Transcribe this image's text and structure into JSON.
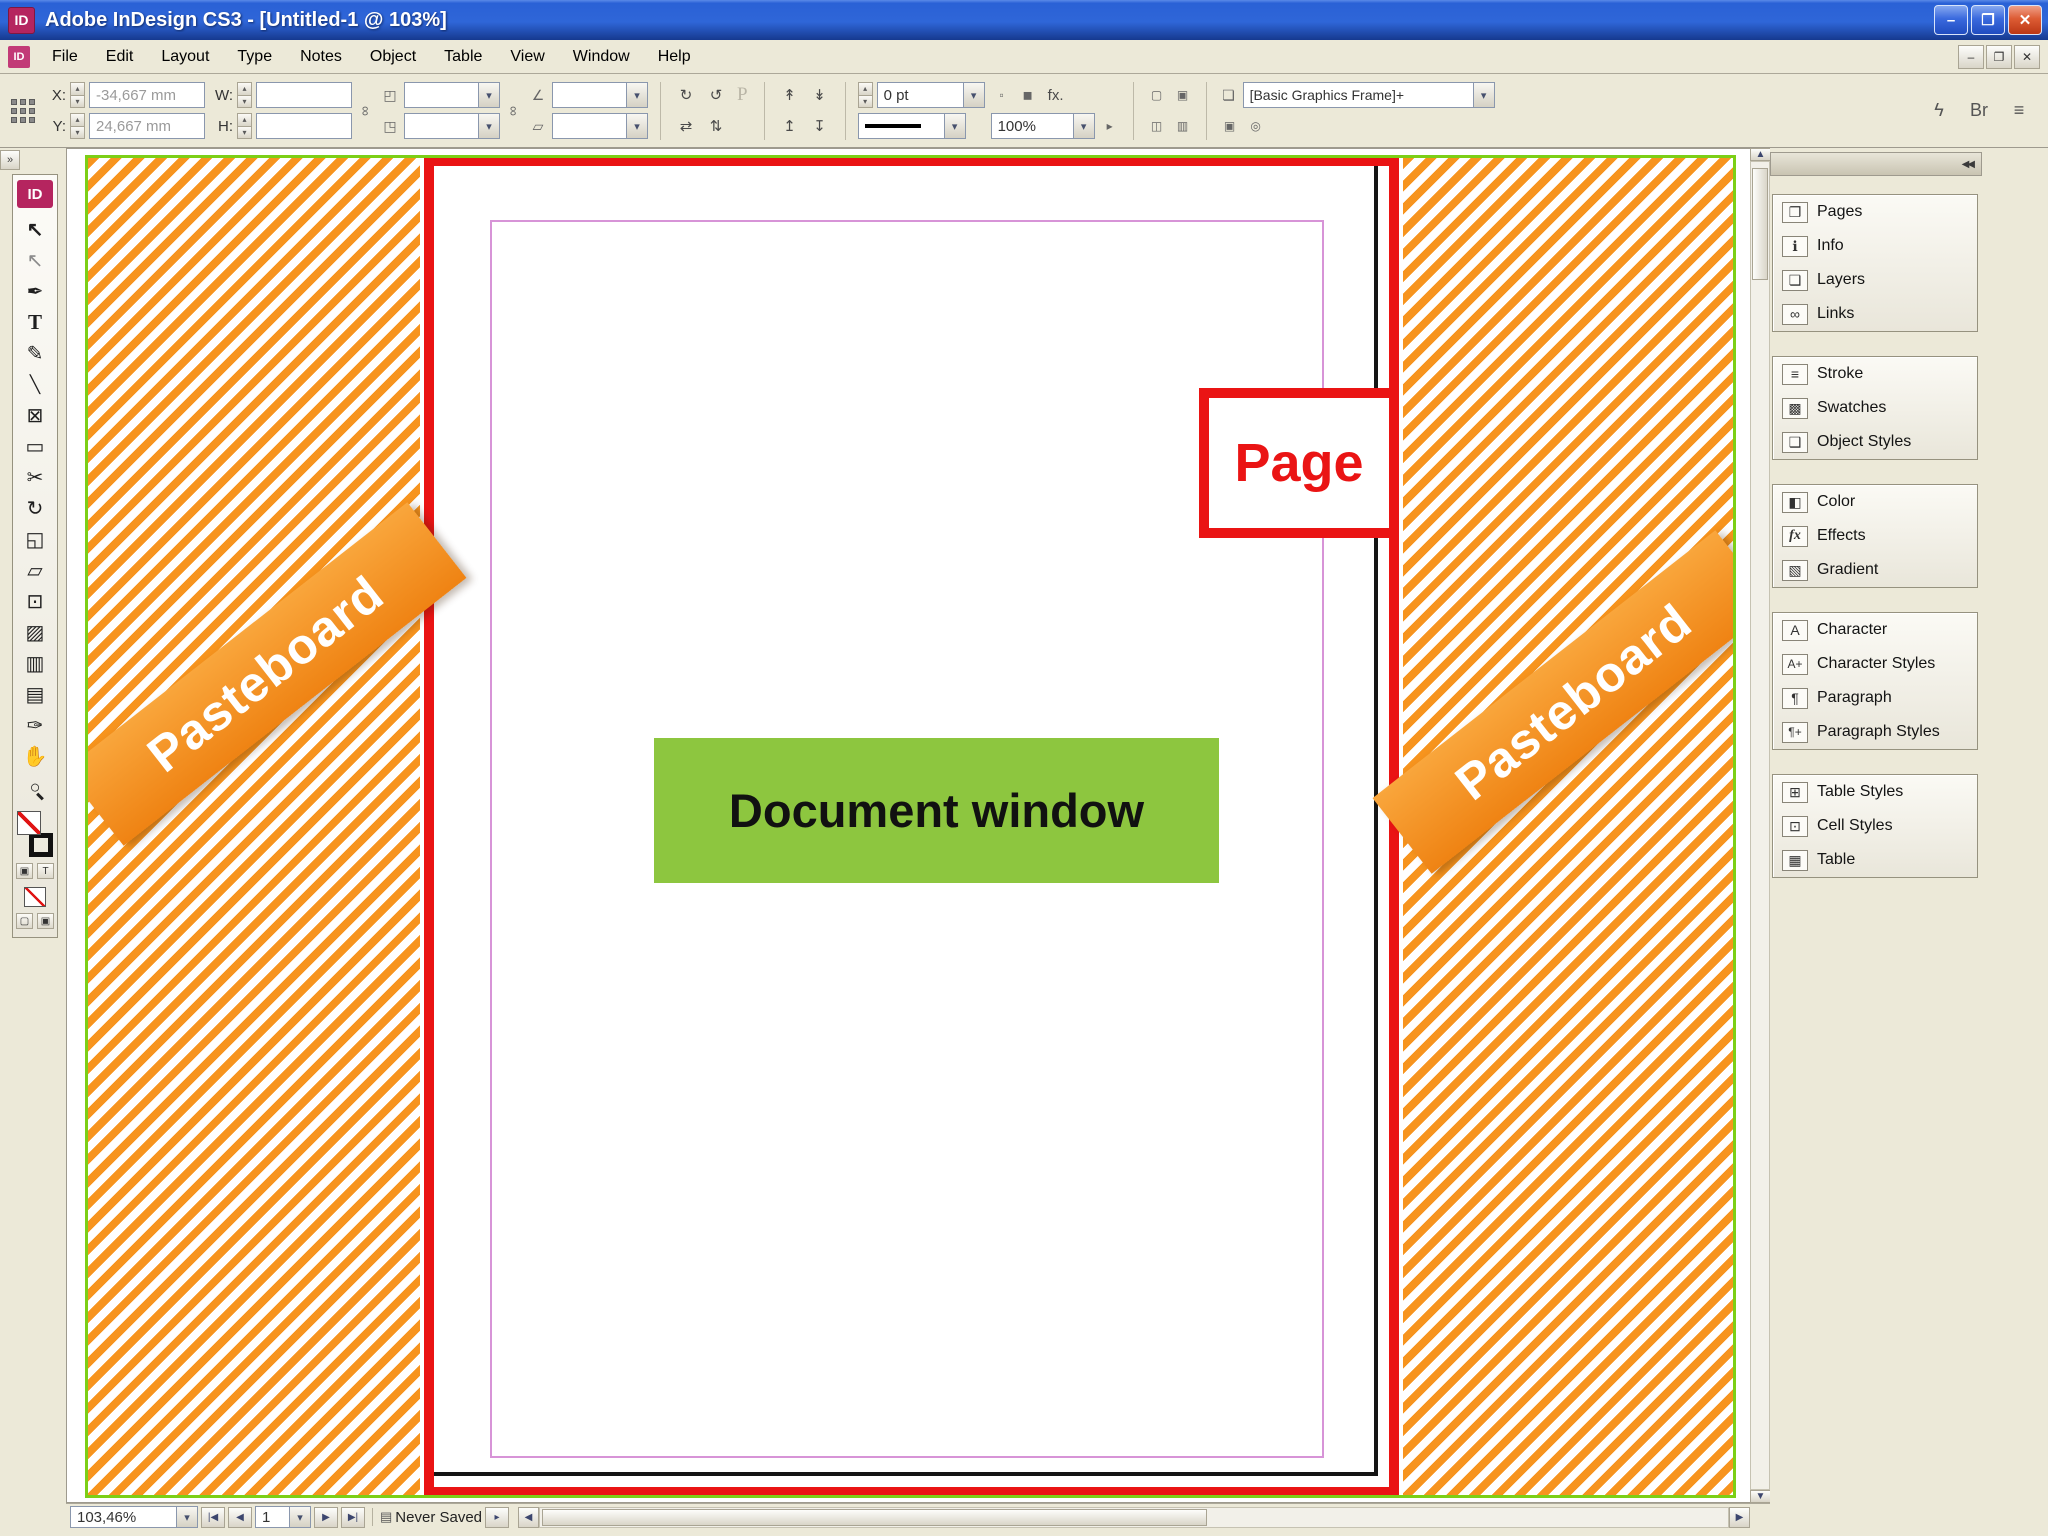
{
  "window": {
    "title": "Adobe InDesign CS3 - [Untitled-1 @ 103%]",
    "app_icon": "ID",
    "controls": {
      "minimize": "–",
      "restore": "❐",
      "close": "✕"
    }
  },
  "menubar": {
    "doc_icon": "ID",
    "items": [
      {
        "name": "menu-file",
        "label": "File"
      },
      {
        "name": "menu-edit",
        "label": "Edit"
      },
      {
        "name": "menu-layout",
        "label": "Layout"
      },
      {
        "name": "menu-type",
        "label": "Type"
      },
      {
        "name": "menu-notes",
        "label": "Notes"
      },
      {
        "name": "menu-object",
        "label": "Object"
      },
      {
        "name": "menu-table",
        "label": "Table"
      },
      {
        "name": "menu-view",
        "label": "View"
      },
      {
        "name": "menu-window",
        "label": "Window"
      },
      {
        "name": "menu-help",
        "label": "Help"
      }
    ],
    "doc_controls": {
      "minimize": "–",
      "restore": "❐",
      "close": "✕"
    }
  },
  "control_panel": {
    "x_label": "X:",
    "x_value": "-34,667 mm",
    "y_label": "Y:",
    "y_value": "24,667 mm",
    "w_label": "W:",
    "w_value": "",
    "h_label": "H:",
    "h_value": "",
    "scale_x_value": "",
    "scale_y_value": "",
    "rotation_value": "",
    "shear_value": "",
    "stroke_weight": "0 pt",
    "opacity": "100%",
    "style_preset": "[Basic Graphics Frame]+",
    "icons": {
      "link": "∞",
      "scale_x": "◰",
      "scale_y": "◳",
      "rotation": "∠",
      "shear": "▱",
      "rotate_cw": "↻",
      "rotate_ccw": "↺",
      "p_indicator": "P",
      "flip_h": "⇄",
      "flip_v": "⇅",
      "select_container": "↟",
      "select_content": "↡",
      "select_prev": "↥",
      "select_next": "↧",
      "fx": "fx.",
      "effect_a": "▫",
      "effect_b": "◼",
      "wrap_none": "▢",
      "wrap_bounds": "▣",
      "wrap_object": "◫",
      "wrap_jump": "▥",
      "style_icon": "❏",
      "fitting": "▣",
      "corner": "◎",
      "quick_apply": "ϟ",
      "bridge": "Br",
      "panel_menu": "≡",
      "arrow_btn": "▸"
    }
  },
  "toolbox": {
    "logo": "ID",
    "collapse_icon": "»",
    "formatting_container": "▣",
    "formatting_text": "T",
    "view_normal": "▢",
    "view_preview": "▣",
    "tools": [
      {
        "name": "selection-tool",
        "glyph": "↖"
      },
      {
        "name": "direct-selection-tool",
        "glyph": "↖"
      },
      {
        "name": "pen-tool",
        "glyph": "✒"
      },
      {
        "name": "type-tool",
        "glyph": "T"
      },
      {
        "name": "pencil-tool",
        "glyph": "✎"
      },
      {
        "name": "line-tool",
        "glyph": "╲"
      },
      {
        "name": "rectangle-frame-tool",
        "glyph": "⊠"
      },
      {
        "name": "rectangle-tool",
        "glyph": "▭"
      },
      {
        "name": "scissors-tool",
        "glyph": "✂"
      },
      {
        "name": "rotate-tool",
        "glyph": "↻"
      },
      {
        "name": "scale-tool",
        "glyph": "◱"
      },
      {
        "name": "shear-tool",
        "glyph": "▱"
      },
      {
        "name": "free-transform-tool",
        "glyph": "⊡"
      },
      {
        "name": "gradient-tool",
        "glyph": "▨"
      },
      {
        "name": "gradient-feather-tool",
        "glyph": "▥"
      },
      {
        "name": "note-tool",
        "glyph": "▤"
      },
      {
        "name": "eyedropper-tool",
        "glyph": "✑"
      },
      {
        "name": "hand-tool",
        "glyph": "✋"
      },
      {
        "name": "zoom-tool",
        "glyph": "○"
      }
    ]
  },
  "canvas": {
    "pasteboard_left_label": "Pasteboard",
    "pasteboard_right_label": "Pasteboard",
    "page_label": "Page",
    "document_window_label": "Document window"
  },
  "dock": {
    "collapse_icon": "◀◀",
    "group1": [
      {
        "name": "panel-pages",
        "glyph": "❐",
        "label": "Pages"
      },
      {
        "name": "panel-info",
        "glyph": "ℹ",
        "label": "Info"
      },
      {
        "name": "panel-layers",
        "glyph": "❏",
        "label": "Layers"
      },
      {
        "name": "panel-links",
        "glyph": "∞",
        "label": "Links"
      }
    ],
    "group2": [
      {
        "name": "panel-stroke",
        "glyph": "≡",
        "label": "Stroke"
      },
      {
        "name": "panel-swatches",
        "glyph": "▩",
        "label": "Swatches"
      },
      {
        "name": "panel-object-styles",
        "glyph": "❑",
        "label": "Object Styles"
      }
    ],
    "group3": [
      {
        "name": "panel-color",
        "glyph": "◧",
        "label": "Color"
      },
      {
        "name": "panel-effects",
        "glyph": "fx",
        "label": "Effects"
      },
      {
        "name": "panel-gradient",
        "glyph": "▧",
        "label": "Gradient"
      }
    ],
    "group4": [
      {
        "name": "panel-character",
        "glyph": "A",
        "label": "Character"
      },
      {
        "name": "panel-character-styles",
        "glyph": "A+",
        "label": "Character Styles"
      },
      {
        "name": "panel-paragraph",
        "glyph": "¶",
        "label": "Paragraph"
      },
      {
        "name": "panel-paragraph-styles",
        "glyph": "¶+",
        "label": "Paragraph Styles"
      }
    ],
    "group5": [
      {
        "name": "panel-table-styles",
        "glyph": "⊞",
        "label": "Table Styles"
      },
      {
        "name": "panel-cell-styles",
        "glyph": "⊡",
        "label": "Cell Styles"
      },
      {
        "name": "panel-table",
        "glyph": "▦",
        "label": "Table"
      }
    ]
  },
  "statusbar": {
    "zoom": "103,46%",
    "nav": {
      "first": "|◀",
      "prev": "◀",
      "page": "1",
      "next": "▶",
      "last": "▶|"
    },
    "saved": "Never Saved",
    "saved_icon": "▤",
    "expand": "▸"
  },
  "icons": {
    "up": "▲",
    "down": "▼",
    "left": "◀",
    "right": "▶"
  },
  "colors": {
    "pasteboard_orange": "#F7941E",
    "page_red": "#EA1414",
    "document_green": "#8DC63F",
    "border_green": "#7CCF16",
    "margin_guide": "#D794D7",
    "titlebar_blue": "#2B63D6"
  }
}
